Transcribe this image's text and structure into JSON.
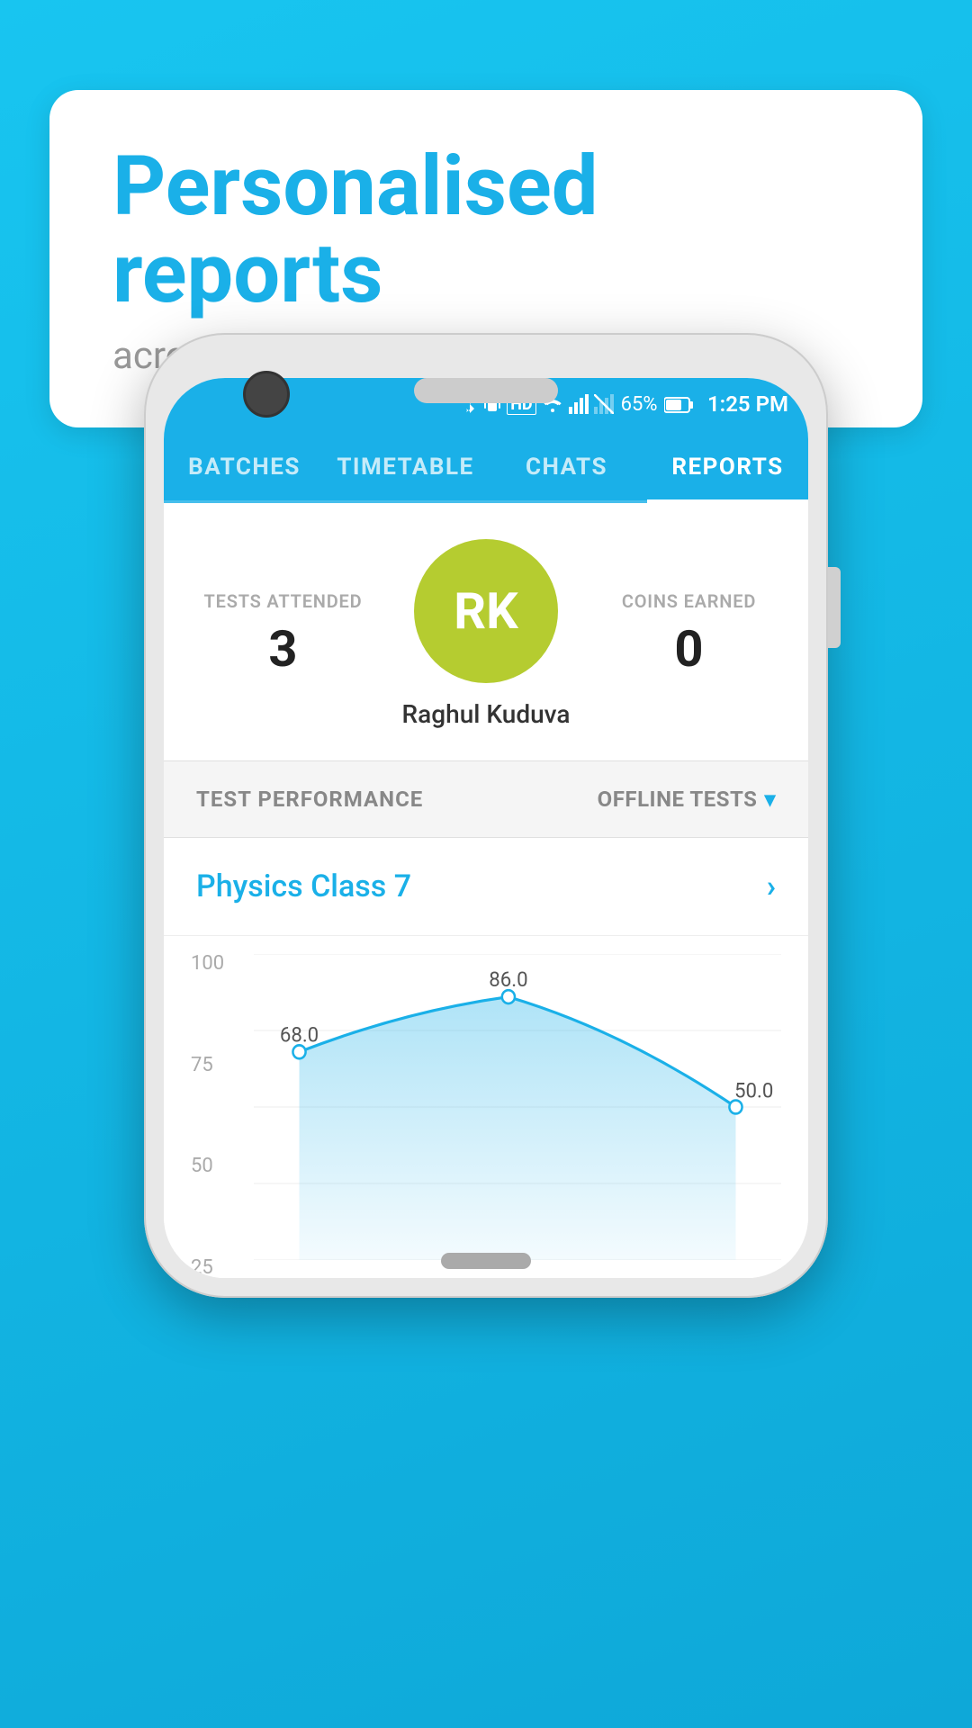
{
  "background": {
    "color": "#18b5e8"
  },
  "bubble": {
    "title": "Personalised reports",
    "subtitle": "across your online & class tests"
  },
  "status_bar": {
    "battery": "65%",
    "time": "1:25 PM",
    "icons": "bluetooth vibrate hd wifi signal signal-x"
  },
  "nav_tabs": [
    {
      "label": "BATCHES",
      "active": false
    },
    {
      "label": "TIMETABLE",
      "active": false
    },
    {
      "label": "CHATS",
      "active": false
    },
    {
      "label": "REPORTS",
      "active": true
    }
  ],
  "profile": {
    "tests_attended_label": "TESTS ATTENDED",
    "tests_attended_value": "3",
    "coins_earned_label": "COINS EARNED",
    "coins_earned_value": "0",
    "avatar_initials": "RK",
    "avatar_name": "Raghul Kuduva"
  },
  "test_performance": {
    "label": "TEST PERFORMANCE",
    "offline_tests_label": "OFFLINE TESTS"
  },
  "class_row": {
    "name": "Physics Class 7"
  },
  "chart": {
    "y_labels": [
      "100",
      "75",
      "50",
      "25"
    ],
    "data_points": [
      {
        "label": "68.0",
        "value": 68
      },
      {
        "label": "86.0",
        "value": 86
      },
      {
        "label": "50.0",
        "value": 50
      }
    ],
    "y_min": 0,
    "y_max": 100
  }
}
